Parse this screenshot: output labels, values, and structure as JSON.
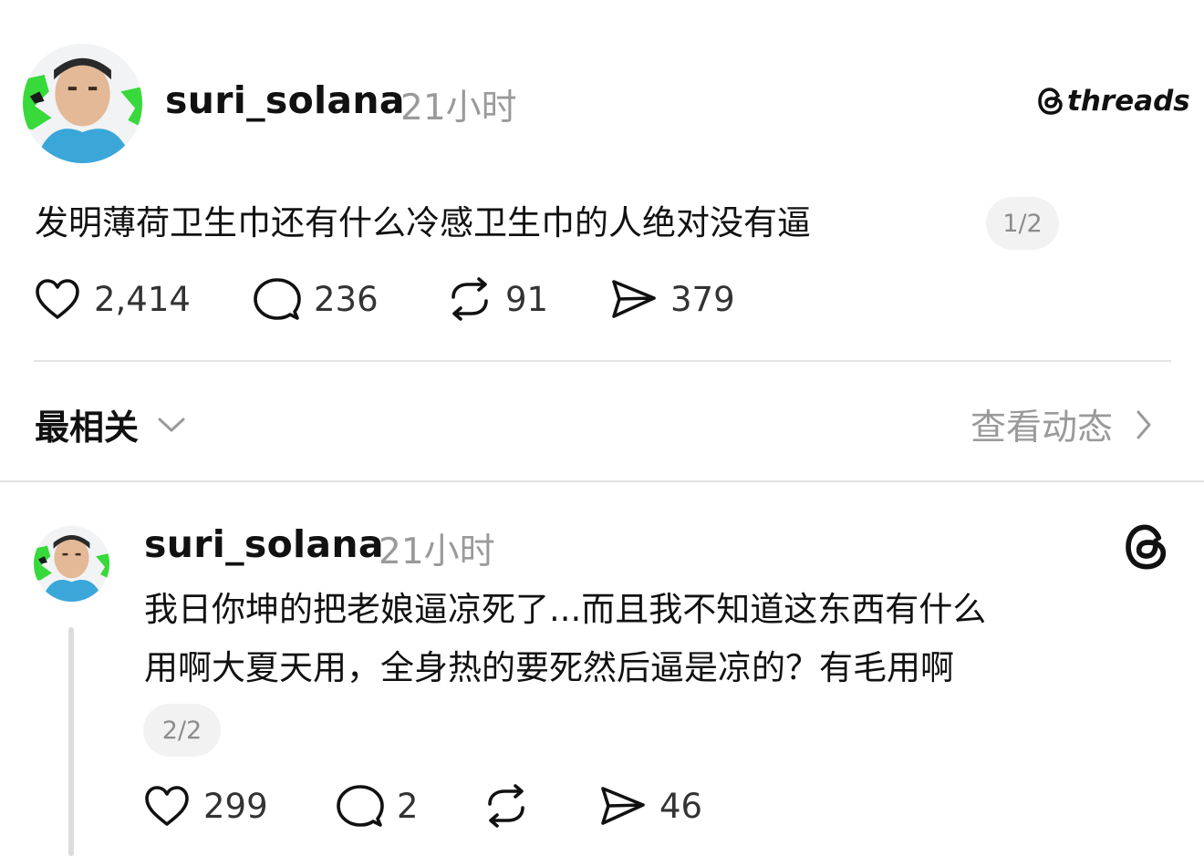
{
  "post": {
    "username": "suri_solana",
    "time": "21小时",
    "brand": "threads",
    "text": "发明薄荷卫生巾还有什么冷感卫生巾的人绝对没有逼",
    "page_indicator": "1/2",
    "stats": {
      "likes": "2,414",
      "replies": "236",
      "reposts": "91",
      "shares": "379"
    }
  },
  "sort": {
    "label": "最相关",
    "activity_link": "查看动态"
  },
  "reply": {
    "username": "suri_solana",
    "time": "21小时",
    "text_line1": "我日你坤的把老娘逼凉死了...而且我不知道这东西有什么",
    "text_line2": "用啊大夏天用，全身热的要死然后逼是凉的？有毛用啊",
    "page_indicator": "2/2",
    "stats": {
      "likes": "299",
      "replies": "2",
      "shares": "46"
    }
  },
  "icons": {
    "like": "heart-icon",
    "reply": "comment-bubble-icon",
    "repost": "repost-icon",
    "share": "send-icon",
    "brand": "threads-logo-icon",
    "sort": "chevron-down-icon",
    "activity": "chevron-right-icon"
  },
  "colors": {
    "text": "#111111",
    "muted": "#9a9a9a",
    "divider": "#e3e3e3",
    "pill_bg": "#f2f2f2"
  }
}
